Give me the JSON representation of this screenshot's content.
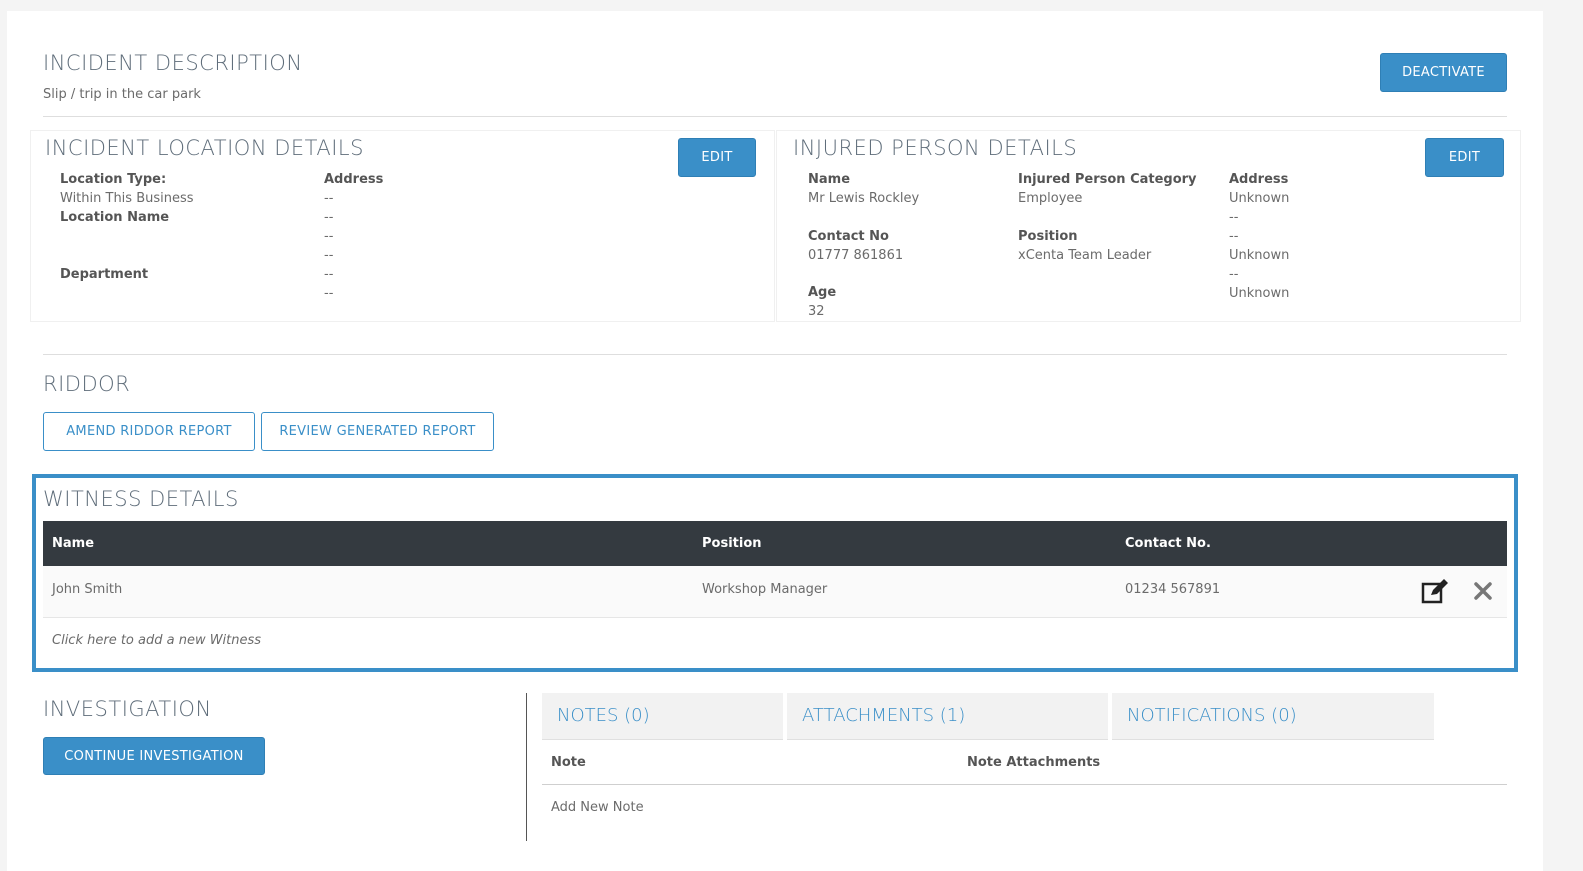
{
  "incident": {
    "title": "INCIDENT DESCRIPTION",
    "description": "Slip / trip in the car park",
    "deactivate_label": "DEACTIVATE"
  },
  "location": {
    "title": "INCIDENT LOCATION DETAILS",
    "edit_label": "EDIT",
    "location_type_label": "Location Type:",
    "location_type_value": "Within This Business",
    "location_name_label": "Location Name",
    "department_label": "Department",
    "address_label": "Address",
    "address_lines": [
      "--",
      "--",
      "--",
      "--",
      "--",
      "--"
    ]
  },
  "injured": {
    "title": "INJURED PERSON DETAILS",
    "edit_label": "EDIT",
    "name_label": "Name",
    "name_value": "Mr Lewis Rockley",
    "contact_label": "Contact No",
    "contact_value": "01777 861861",
    "age_label": "Age",
    "age_value": "32",
    "category_label": "Injured Person Category",
    "category_value": "Employee",
    "position_label": "Position",
    "position_value": "xCenta Team Leader",
    "address_label": "Address",
    "address_lines": [
      "Unknown",
      "--",
      "--",
      "Unknown",
      "--",
      "Unknown"
    ]
  },
  "riddor": {
    "title": "RIDDOR",
    "amend_label": "AMEND RIDDOR REPORT",
    "review_label": "REVIEW GENERATED REPORT"
  },
  "witness": {
    "title": "WITNESS DETAILS",
    "columns": [
      "Name",
      "Position",
      "Contact No."
    ],
    "rows": [
      {
        "name": "John Smith",
        "position": "Workshop Manager",
        "contact": "01234 567891"
      }
    ],
    "add_text": "Click here to add a new Witness"
  },
  "investigation": {
    "title": "INVESTIGATION",
    "continue_label": "CONTINUE INVESTIGATION"
  },
  "tabs": {
    "notes": "NOTES (0)",
    "attachments": "ATTACHMENTS (1)",
    "notifications": "NOTIFICATIONS (0)"
  },
  "notes_table": {
    "col_note": "Note",
    "col_attachments": "Note Attachments",
    "add_note": "Add New Note"
  },
  "colors": {
    "accent": "#3a8fc8",
    "table_header": "#343a40"
  }
}
